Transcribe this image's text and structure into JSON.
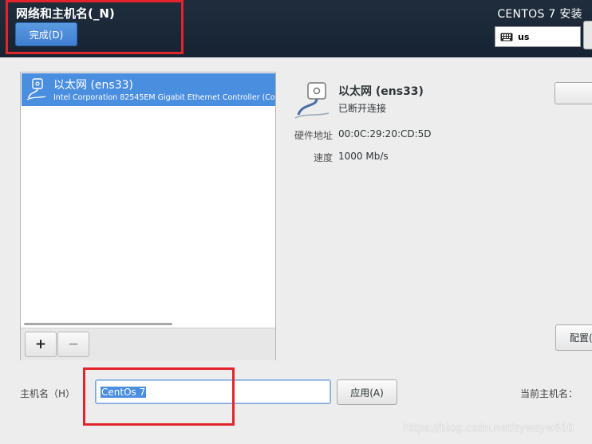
{
  "header": {
    "title": "网络和主机名(_N)",
    "done_label": "完成(D)",
    "product_title": "CENTOS 7 安装",
    "keyboard_layout": "us"
  },
  "devices": {
    "items": [
      {
        "name": "以太网 (ens33)",
        "description": "Intel Corporation 82545EM Gigabit Ethernet Controller (Co",
        "icon": "ethernet-cable-icon",
        "selected": true
      }
    ],
    "add_label": "+",
    "remove_label": "−"
  },
  "detail": {
    "name": "以太网 (ens33)",
    "status": "已断开连接",
    "hw_label": "硬件地址",
    "hw_value": "00:0C:29:20:CD:5D",
    "speed_label": "速度",
    "speed_value": "1000 Mb/s",
    "configure_label": "配置(O)..."
  },
  "hostname": {
    "label": "主机名（H）",
    "value": "CentOs 7",
    "apply_label": "应用(A)",
    "current_label": "当前主机名："
  },
  "watermark": "https://blog.csdn.net/zywzyw810",
  "colors": {
    "header_bg": "#1f2d3d",
    "accent": "#4a8ee0",
    "annotation": "#e3242b"
  }
}
